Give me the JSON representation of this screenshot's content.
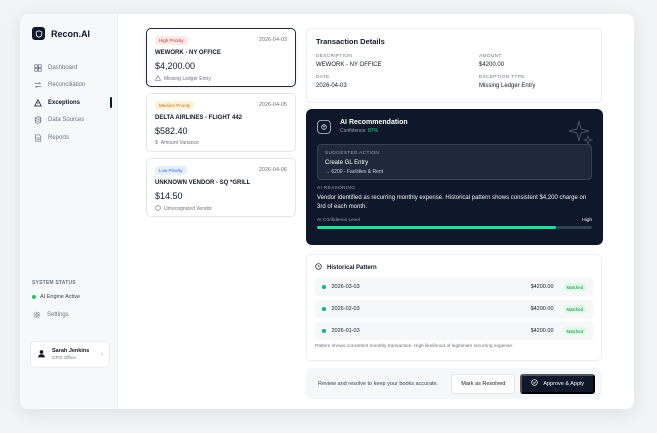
{
  "app": {
    "name": "Recon.AI"
  },
  "sidebar": {
    "items": [
      {
        "label": "Dashboard",
        "icon": "dashboard-icon"
      },
      {
        "label": "Reconciliation",
        "icon": "reconciliation-icon"
      },
      {
        "label": "Exceptions",
        "icon": "warning-icon",
        "active": true
      },
      {
        "label": "Data Sources",
        "icon": "database-icon"
      },
      {
        "label": "Reports",
        "icon": "report-icon"
      }
    ],
    "status_title": "SYSTEM STATUS",
    "status_text": "AI Engine Active",
    "settings_label": "Settings",
    "user": {
      "name": "Sarah Jenkins",
      "role": "CFO Office"
    }
  },
  "exceptions": [
    {
      "priority": "High Priority",
      "level": "high",
      "date": "2026-04-03",
      "vendor": "WEWORK - NY OFFICE",
      "amount": "$4,200.00",
      "issue": "Missing Ledger Entry"
    },
    {
      "priority": "Medium Priority",
      "level": "medium",
      "date": "2026-04-05",
      "vendor": "DELTA AIRLINES - FLIGHT 442",
      "amount": "$582.40",
      "issue": "Amount Variance"
    },
    {
      "priority": "Low Priority",
      "level": "low",
      "date": "2026-04-06",
      "vendor": "UNKNOWN VENDOR - SQ *GRILL",
      "amount": "$14.50",
      "issue": "Unrecognized Vendor"
    }
  ],
  "details": {
    "title": "Transaction Details",
    "description_label": "DESCRIPTION",
    "description": "WEWORK - NY OFFICE",
    "amount_label": "AMOUNT",
    "amount": "$4200.00",
    "date_label": "DATE",
    "date": "2026-04-03",
    "type_label": "EXCEPTION TYPE",
    "type": "Missing Ledger Entry"
  },
  "ai": {
    "title": "AI Recommendation",
    "confidence_label": "Confidence:",
    "confidence": "87%",
    "suggested_label": "SUGGESTED ACTION",
    "action": "Create GL Entry",
    "action_detail": "→ 6200 - Facilities & Rent",
    "reasoning_label": "AI REASONING",
    "reasoning": "Vendor identified as recurring monthly expense. Historical pattern shows consistent $4,200 charge on 3rd of each month.",
    "level_label": "AI Confidence Level",
    "level_value": "High",
    "level_fraction": 0.87
  },
  "history": {
    "title": "Historical Pattern",
    "rows": [
      {
        "date": "2026-03-03",
        "amount": "$4200.00",
        "status": "Matched"
      },
      {
        "date": "2026-02-03",
        "amount": "$4200.00",
        "status": "Matched"
      },
      {
        "date": "2026-01-03",
        "amount": "$4200.00",
        "status": "Matched"
      }
    ],
    "note": "Pattern shows consistent monthly transaction. High likelihood of legitimate recurring expense."
  },
  "footer": {
    "text": "Review and resolve to keep your books accurate.",
    "secondary_label": "Mark as Resolved",
    "primary_label": "Approve & Apply"
  },
  "colors": {
    "accent": "#0f172a",
    "success": "#34d399",
    "high": "#c0392b",
    "medium": "#b7791f",
    "low": "#2563eb"
  }
}
